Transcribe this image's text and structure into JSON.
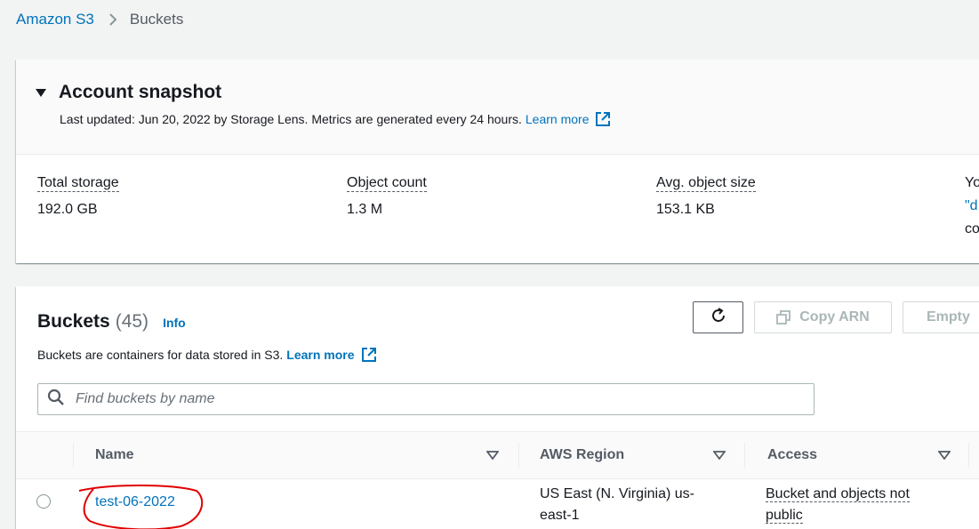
{
  "breadcrumb": {
    "root": "Amazon S3",
    "current": "Buckets"
  },
  "snapshot": {
    "title": "Account snapshot",
    "subtitle": "Last updated: Jun 20, 2022 by Storage Lens. Metrics are generated every 24 hours.",
    "learn_more": "Learn more",
    "metrics": [
      {
        "label": "Total storage",
        "value": "192.0 GB"
      },
      {
        "label": "Object count",
        "value": "1.3 M"
      },
      {
        "label": "Avg. object size",
        "value": "153.1 KB"
      }
    ],
    "cutoff": {
      "line1": "Yo",
      "line2": "\"d",
      "line3": "co"
    }
  },
  "buckets": {
    "title": "Buckets",
    "count": "(45)",
    "info": "Info",
    "description": "Buckets are containers for data stored in S3.",
    "learn_more": "Learn more",
    "buttons": {
      "copy_arn": "Copy ARN",
      "empty": "Empty"
    },
    "search": {
      "placeholder": "Find buckets by name",
      "value": ""
    },
    "columns": [
      "Name",
      "AWS Region",
      "Access"
    ],
    "rows": [
      {
        "name": "test-06-2022",
        "region": "US East (N. Virginia) us-east-1",
        "region_line1": "US East (N. Virginia) us-",
        "region_line2": "east-1",
        "access_line1": "Bucket and objects not",
        "access_line2": "public"
      }
    ]
  },
  "colors": {
    "link": "#0073bb",
    "annotation": "#e00000",
    "background": "#f2f3f3"
  }
}
